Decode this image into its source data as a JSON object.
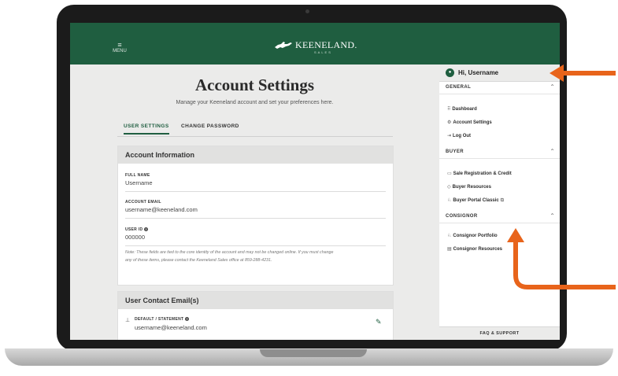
{
  "header": {
    "menu_icon": "hamburger-icon",
    "menu_label": "MENU",
    "logo_text": "KEENELAND.",
    "logo_sub": "SALES",
    "logo_icon": "horse-jockey-icon"
  },
  "main": {
    "title": "Account Settings",
    "subtitle": "Manage your Keeneland account and set your preferences here.",
    "tabs": [
      {
        "label": "USER SETTINGS",
        "active": true
      },
      {
        "label": "CHANGE PASSWORD",
        "active": false
      }
    ],
    "account_info": {
      "heading": "Account Information",
      "full_name_label": "FULL NAME",
      "full_name": "Username",
      "email_label": "ACCOUNT EMAIL",
      "email": "username@keeneland.com",
      "user_id_label": "USER ID",
      "user_id_icon": "help-icon",
      "user_id": "000000",
      "note_line1": "Note: These fields are tied to the core identity of the account and may not be changed online. If you must change",
      "note_line2": "any of these items, please contact the Keeneland Sales office at 859-288-4231."
    },
    "contact_email": {
      "heading": "User Contact Email(s)",
      "default_label": "DEFAULT / STATEMENT",
      "default_email": "username@keeneland.com",
      "pin_icon": "pin-icon",
      "edit_icon": "edit-icon"
    }
  },
  "sidebar": {
    "greeting": "Hi, Username",
    "avatar_icon": "user-icon",
    "sections": {
      "general": {
        "title": "GENERAL",
        "items": [
          "Dashboard",
          "Account Settings",
          "Log Out"
        ]
      },
      "buyer": {
        "title": "BUYER",
        "items": [
          "Sale Registration & Credit",
          "Buyer Resources",
          "Buyer Portal Classic"
        ]
      },
      "consignor": {
        "title": "CONSIGNOR",
        "items": [
          "Consignor Portfolio",
          "Consignor Resources"
        ]
      }
    },
    "faq": "FAQ & SUPPORT"
  },
  "colors": {
    "brand_green": "#1f5e40",
    "arrow_orange": "#e8641b"
  }
}
